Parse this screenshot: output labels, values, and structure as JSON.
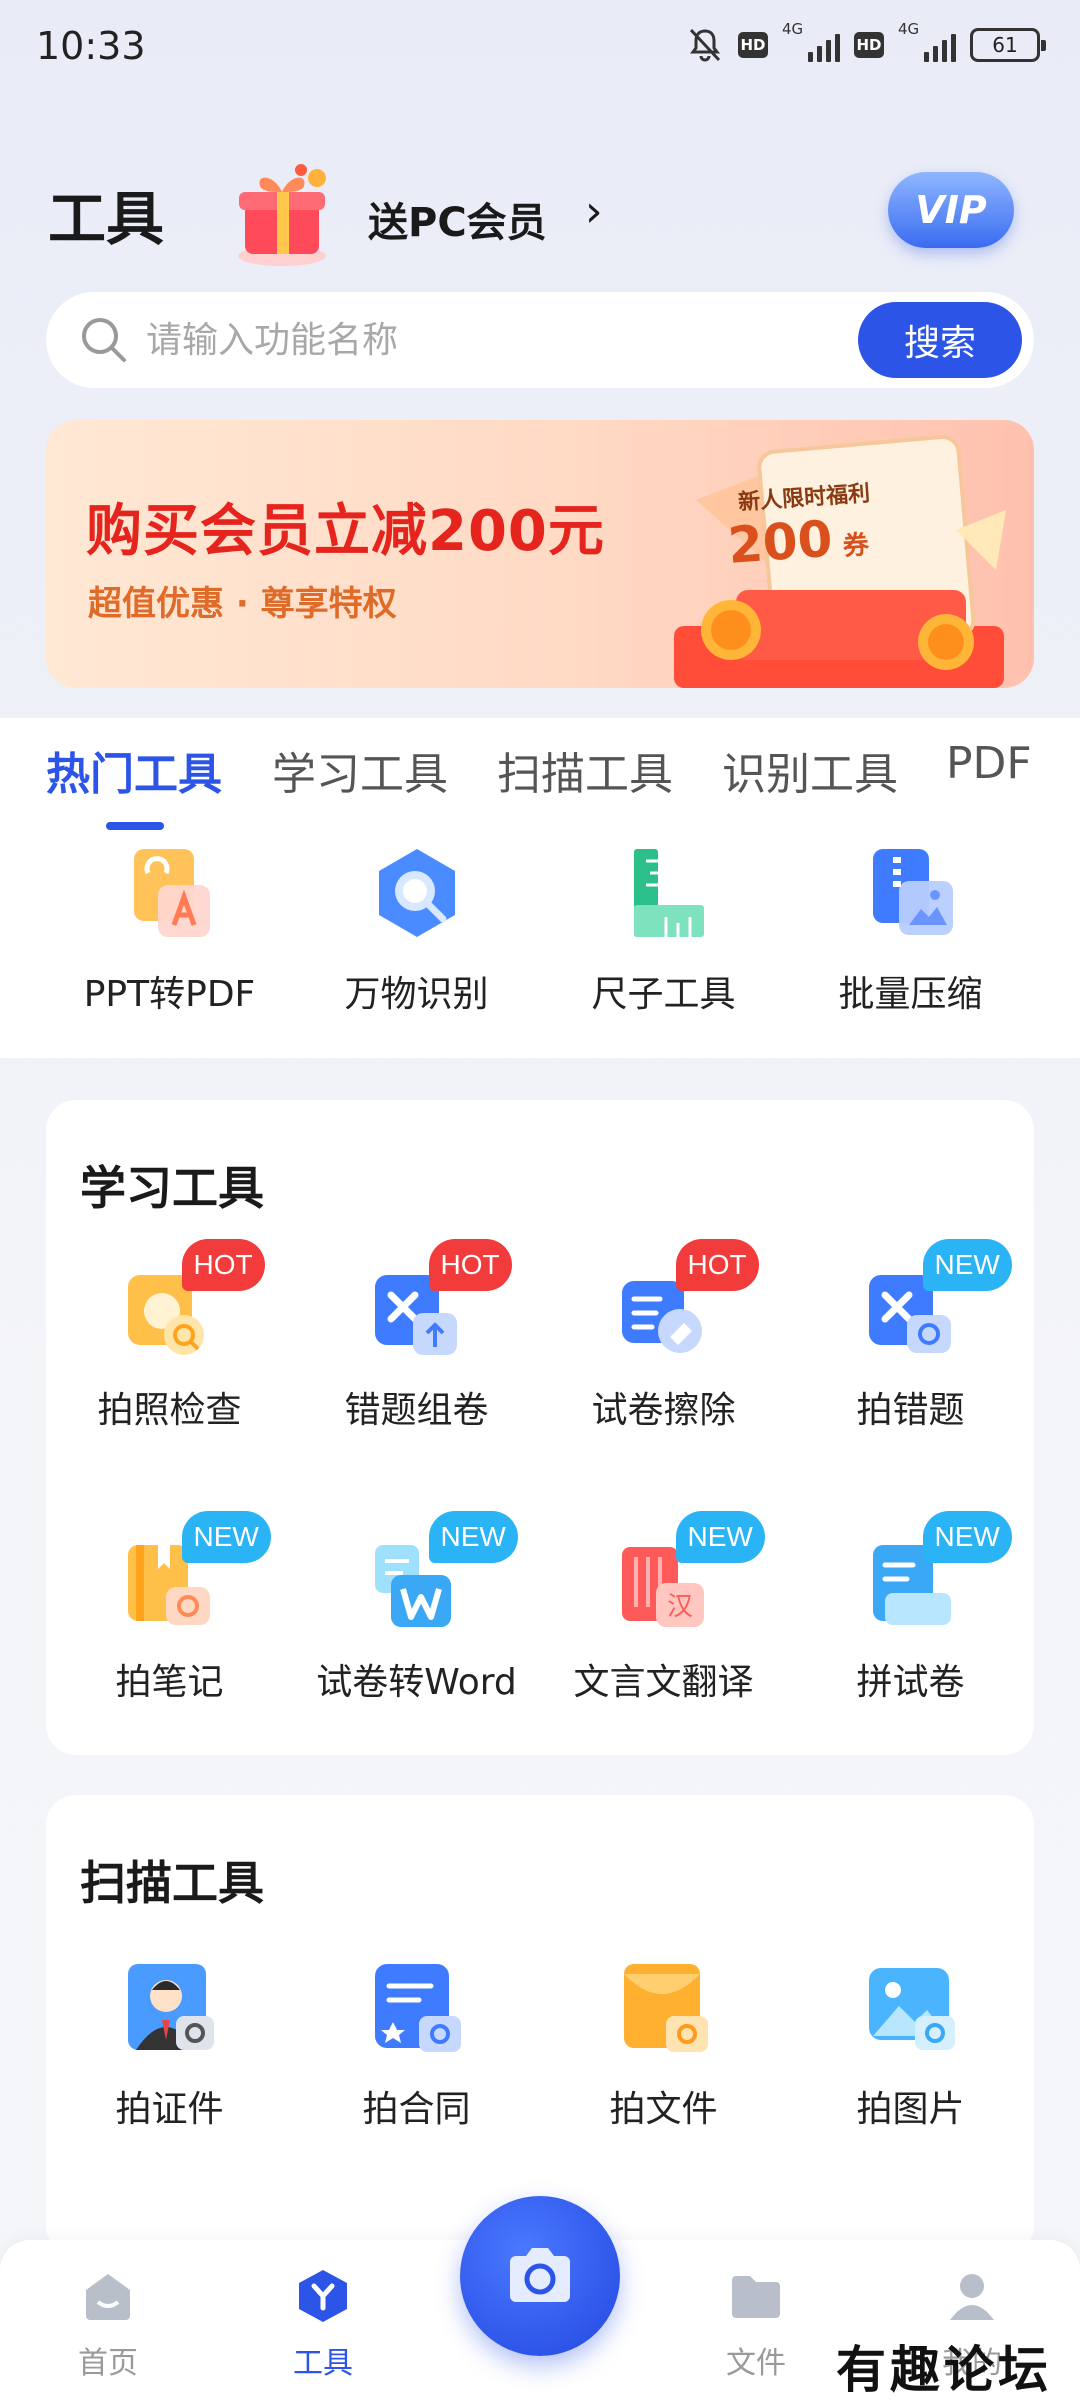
{
  "status_bar": {
    "time": "10:33",
    "network": "4G",
    "battery": "61"
  },
  "header": {
    "title": "工具",
    "promo_text": "送PC会员",
    "promo_arrow": "›",
    "vip_label": "VIP"
  },
  "search": {
    "placeholder": "请输入功能名称",
    "button_label": "搜索"
  },
  "banner": {
    "title_prefix": "购买会员立减",
    "title_amount": "200元",
    "subtitle": "超值优惠 · 尊享特权",
    "coupon_label": "新人限时福利",
    "coupon_value": "200",
    "coupon_unit": "券"
  },
  "tabs": [
    {
      "label": "热门工具",
      "active": true
    },
    {
      "label": "学习工具",
      "active": false
    },
    {
      "label": "扫描工具",
      "active": false
    },
    {
      "label": "识别工具",
      "active": false
    },
    {
      "label": "PDF",
      "active": false
    }
  ],
  "hot_tools": [
    {
      "label": "PPT转PDF",
      "icon": "ppt-to-pdf-icon"
    },
    {
      "label": "万物识别",
      "icon": "recognize-icon"
    },
    {
      "label": "尺子工具",
      "icon": "ruler-icon"
    },
    {
      "label": "批量压缩",
      "icon": "compress-icon"
    }
  ],
  "study_section": {
    "title": "学习工具",
    "tools": [
      {
        "label": "拍照检查",
        "badge": "HOT",
        "icon": "photo-check-icon"
      },
      {
        "label": "错题组卷",
        "badge": "HOT",
        "icon": "mistake-paper-icon"
      },
      {
        "label": "试卷擦除",
        "badge": "HOT",
        "icon": "paper-erase-icon"
      },
      {
        "label": "拍错题",
        "badge": "NEW",
        "icon": "snap-mistake-icon"
      },
      {
        "label": "拍笔记",
        "badge": "NEW",
        "icon": "snap-notes-icon"
      },
      {
        "label": "试卷转Word",
        "badge": "NEW",
        "icon": "paper-to-word-icon"
      },
      {
        "label": "文言文翻译",
        "badge": "NEW",
        "icon": "classical-translate-icon"
      },
      {
        "label": "拼试卷",
        "badge": "NEW",
        "icon": "merge-paper-icon"
      }
    ]
  },
  "scan_section": {
    "title": "扫描工具",
    "tools": [
      {
        "label": "拍证件",
        "icon": "id-card-icon"
      },
      {
        "label": "拍合同",
        "icon": "contract-icon"
      },
      {
        "label": "拍文件",
        "icon": "document-icon"
      },
      {
        "label": "拍图片",
        "icon": "picture-icon"
      }
    ]
  },
  "bottom_nav": [
    {
      "label": "首页",
      "icon": "home-icon",
      "active": false
    },
    {
      "label": "工具",
      "icon": "tools-icon",
      "active": true
    },
    {
      "label": "文件",
      "icon": "folder-icon",
      "active": false
    },
    {
      "label": "我的",
      "icon": "profile-icon",
      "active": false
    }
  ],
  "watermark": "有趣论坛",
  "colors": {
    "accent": "#2c55e8",
    "hot_badge": "#f23b3b",
    "new_badge": "#2ab3f5",
    "banner_red": "#e6241e"
  }
}
